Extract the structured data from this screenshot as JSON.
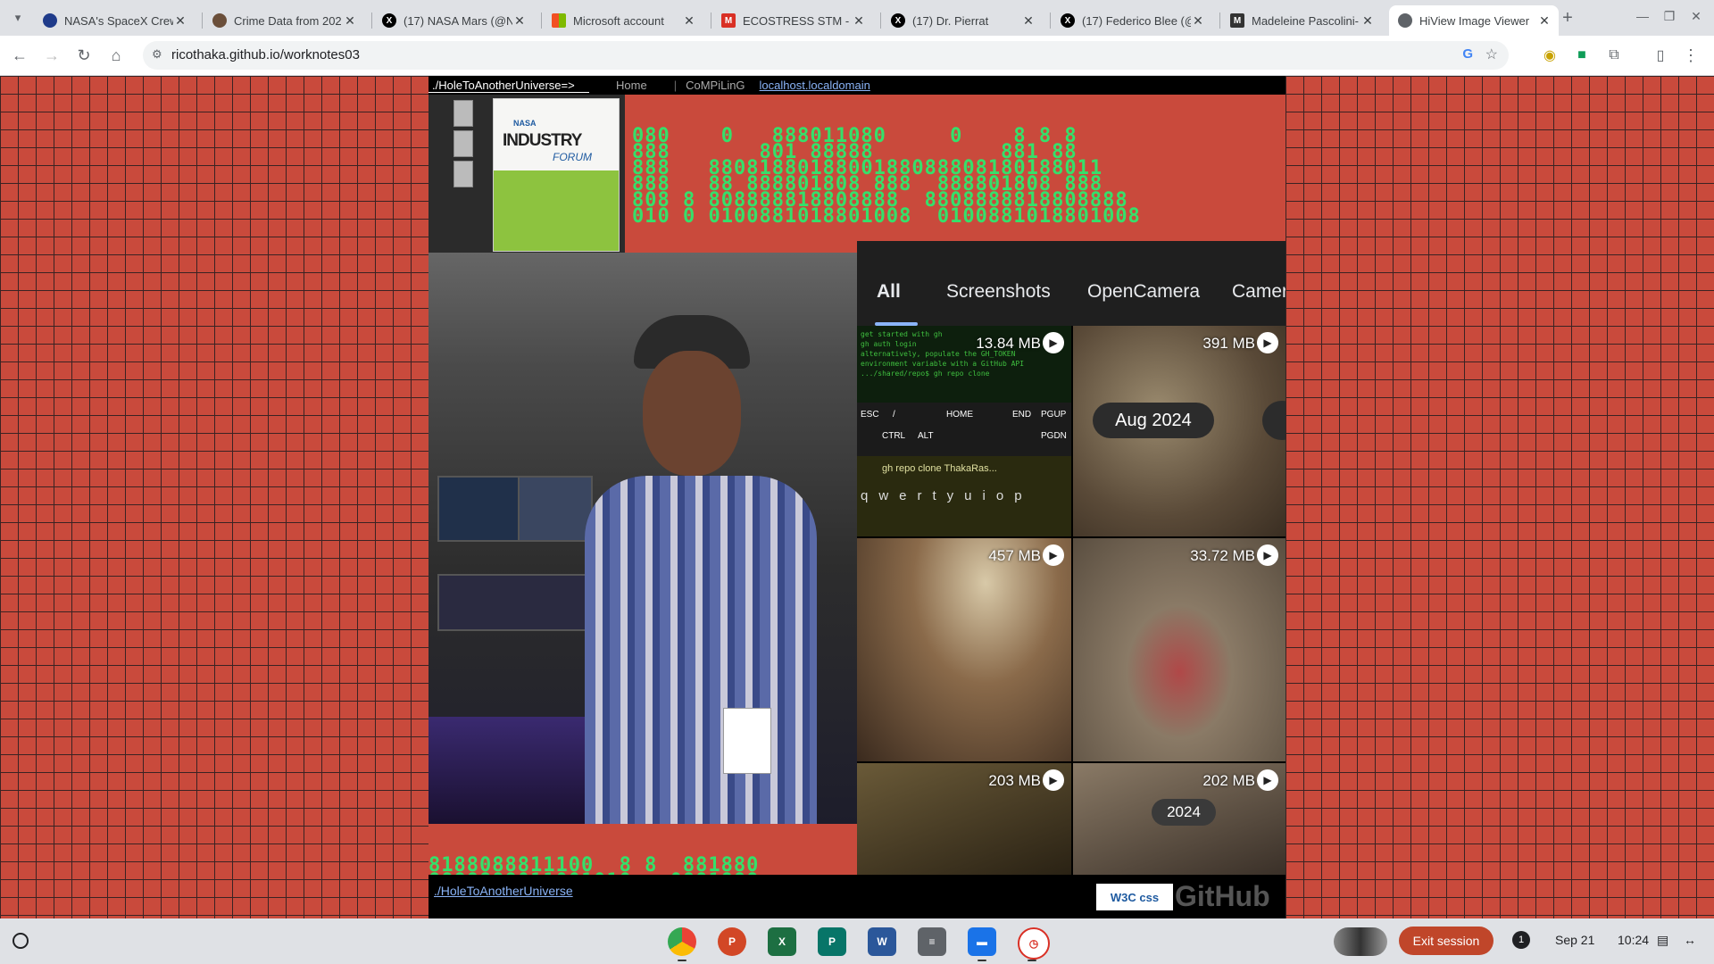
{
  "browser": {
    "tabs": [
      {
        "title": "NASA's SpaceX Crew-",
        "fav_color": "#1f3b8a"
      },
      {
        "title": "Crime Data from 202",
        "fav_color": "#6b4f3a"
      },
      {
        "title": "(17) NASA Mars (@N",
        "fav_color": "#000000"
      },
      {
        "title": "Microsoft account",
        "fav_color": "#f25022"
      },
      {
        "title": "ECOSTRESS STM - ho",
        "fav_color": "#d93025"
      },
      {
        "title": "(17) Dr. Pierrat",
        "fav_color": "#000000"
      },
      {
        "title": "(17) Federico Blee (@",
        "fav_color": "#000000"
      },
      {
        "title": "Madeleine Pascolini-",
        "fav_color": "#333333"
      },
      {
        "title": "HiView Image Viewer",
        "fav_color": "#5f6368"
      }
    ],
    "url": "ricothaka.github.io/worknotes03"
  },
  "page": {
    "nav": {
      "path": "./HoleToAnotherUniverse=>",
      "home": "Home",
      "separator": "|",
      "compiling": "CoMPiLinG",
      "localhost": "localhost.localdomain"
    },
    "nasa_doc": {
      "agency": "NASA",
      "title": "INDUSTRY",
      "subtitle": "FORUM"
    },
    "matrix_text": "080 888 8011808 888 80800 888801808 808888818 0100881018",
    "photos": {
      "tabs": [
        "All",
        "Screenshots",
        "OpenCamera",
        "Camera"
      ],
      "items": [
        {
          "size": "13.84 MB"
        },
        {
          "size": "391 MB"
        },
        {
          "size": "457 MB"
        },
        {
          "size": "33.72 MB"
        },
        {
          "size": "203 MB"
        },
        {
          "size": "202 MB"
        }
      ],
      "date_pill": "Aug 2024",
      "year_pill": "2024",
      "terminal_cmd": "gh repo clone ThakaRas..."
    },
    "footer": {
      "link": "./HoleToAnotherUniverse",
      "w3c": "W3C css",
      "github": "GitHub"
    }
  },
  "shelf": {
    "exit_label": "Exit session",
    "notifications": "1",
    "date": "Sep 21",
    "time": "10:24"
  }
}
